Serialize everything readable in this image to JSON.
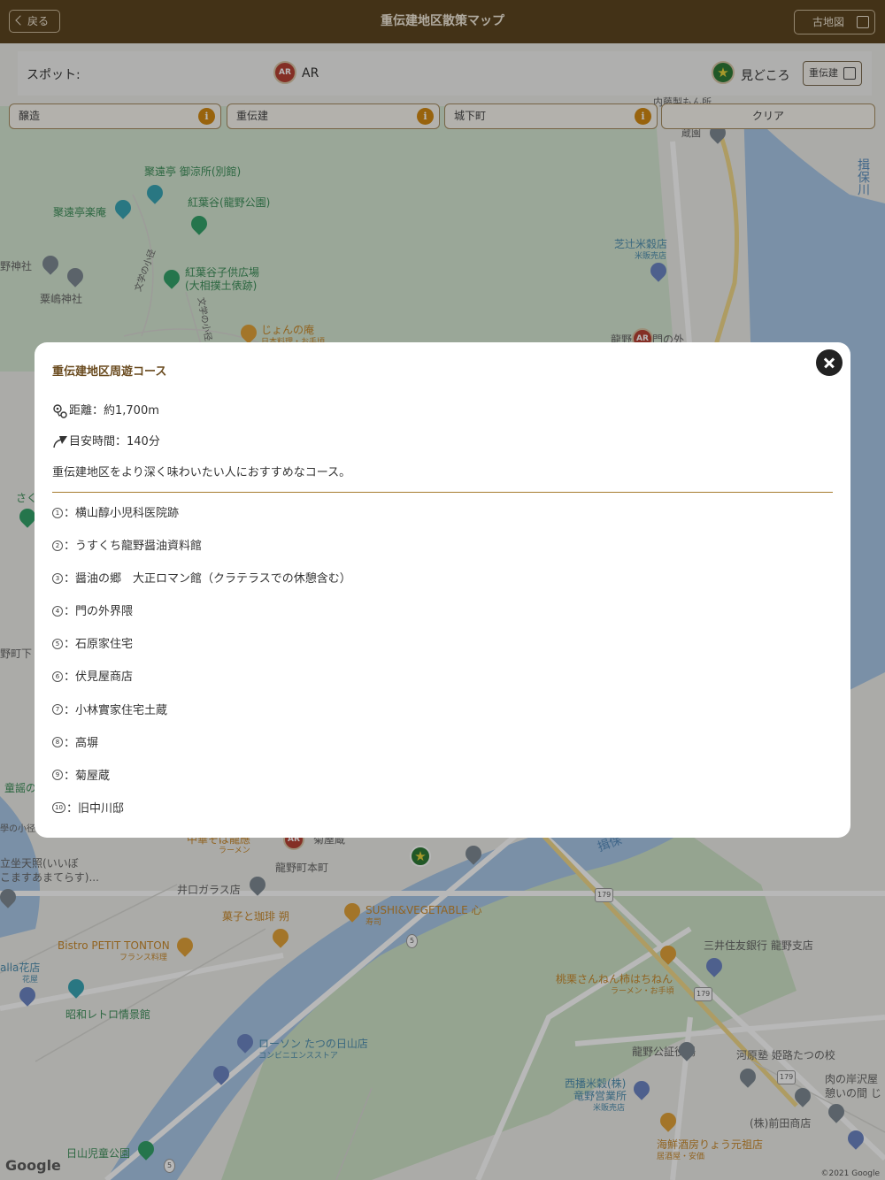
{
  "header": {
    "title": "重伝建地区散策マップ",
    "back_label": "戻る",
    "old_map_label": "古地図"
  },
  "spot_bar": {
    "label": "スポット:",
    "ar_badge": "AR",
    "ar_label": "AR",
    "sights_label": "見どころ",
    "jdk_label": "重伝建"
  },
  "filters": [
    {
      "label": "醸造",
      "info": "i"
    },
    {
      "label": "重伝建",
      "info": "i"
    },
    {
      "label": "城下町",
      "info": "i"
    },
    {
      "label": "クリア"
    }
  ],
  "map": {
    "labels": {
      "l01": "聚遠亭 御涼所(別館)",
      "l02": "聚遠亭楽庵",
      "l03": "紅葉谷(龍野公園)",
      "l04": "野神社",
      "l05": "粟嶋神社",
      "l06": "紅葉谷子供広場",
      "l07": "(大相撲土俵跡)",
      "l08": "文学の小径",
      "l09": "文学の小径",
      "l10": "じょんの庵",
      "l11": "日本料理・お手頃",
      "l12": "芝辻米穀店",
      "l13": "米販売店",
      "l14": "揖保川",
      "l15": "内藤製もん所",
      "l16": "蔵園",
      "l17": "龍野",
      "l18": "門の外",
      "l19": "さく",
      "l20": "野町下",
      "l21": "童謡の",
      "l22": "學の小径",
      "l23": "中華そば龍應",
      "l24": "ラーメン",
      "l25": "菊屋蔵",
      "l26": "龍野町本町",
      "l27": "揖保",
      "l28": "立坐天照(いいぼ",
      "l29": "こますあまてらす)...",
      "l30": "井口ガラス店",
      "l31": "菓子と珈琲 朔",
      "l32": "SUSHI&VEGETABLE 心",
      "l33": "寿司",
      "l34": "Bistro PETIT TONTON",
      "l35": "フランス料理",
      "l36": "alla花店",
      "l37": "花屋",
      "l38": "昭和レトロ情景館",
      "l39": "三井住友銀行 龍野支店",
      "l40": "桃栗さんねん柿はちねん",
      "l41": "ラーメン・お手頃",
      "l42": "ローソン たつの日山店",
      "l43": "コンビニエンスストア",
      "l44": "龍野公証役場",
      "l45": "河原塾 姫路たつの校",
      "l46": "肉の岸沢屋",
      "l47": "憩いの間 じ",
      "l48": "西播米穀(株)",
      "l49": "竜野営業所",
      "l50": "米販売店",
      "l51": "(株)前田商店",
      "l52": "海鮮酒房りょう元祖店",
      "l53": "居酒屋・安価",
      "l54": "日山児童公園"
    },
    "road_shields": [
      "179",
      "179",
      "179",
      "5",
      "5"
    ],
    "ar_marker": "AR",
    "google_logo": "Google",
    "copyright": "©2021 Google"
  },
  "modal": {
    "title": "重伝建地区周遊コース",
    "distance": "距離：約1,700m",
    "duration": "目安時間：140分",
    "description": "重伝建地区をより深く味わいたい人におすすめなコース。",
    "stops": [
      {
        "num": "1",
        "text": "：横山醇小児科医院跡"
      },
      {
        "num": "2",
        "text": "：うすくち龍野醤油資料館"
      },
      {
        "num": "3",
        "text": "：醤油の郷　大正ロマン館（クラテラスでの休憩含む）"
      },
      {
        "num": "4",
        "text": "：門の外界隈"
      },
      {
        "num": "5",
        "text": "：石原家住宅"
      },
      {
        "num": "6",
        "text": "：伏見屋商店"
      },
      {
        "num": "7",
        "text": "：小林實家住宅土蔵"
      },
      {
        "num": "8",
        "text": "：高塀"
      },
      {
        "num": "9",
        "text": "：菊屋蔵"
      },
      {
        "num": "10",
        "text": "：旧中川邸"
      }
    ]
  }
}
